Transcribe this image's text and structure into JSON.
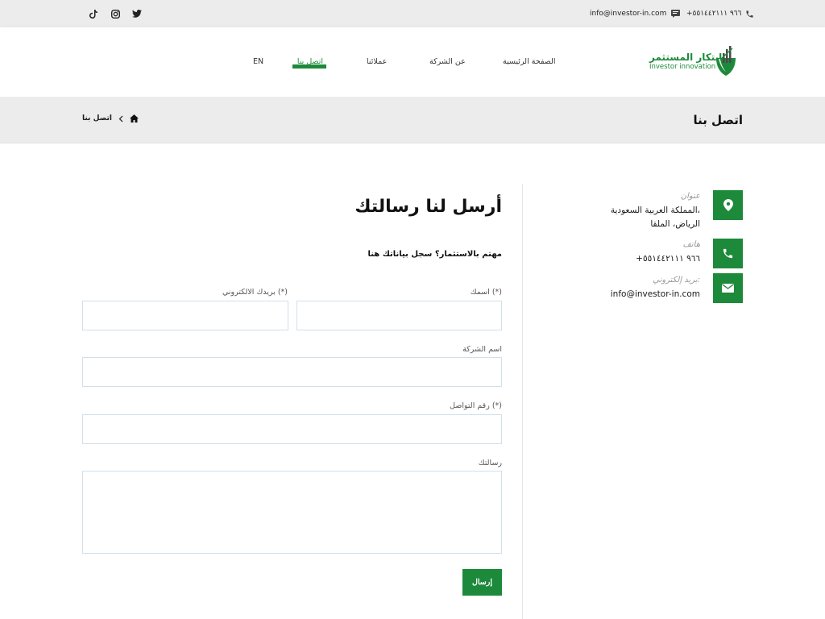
{
  "topbar": {
    "phone": "+٩٦٦ ٥٥١٤٤٢١١١",
    "email": "info@investor-in.com",
    "social": [
      "twitter-icon",
      "instagram-icon",
      "tiktok-icon"
    ]
  },
  "header": {
    "logo_ar": "ابتكار المستثمر",
    "logo_en": "Investor innovation",
    "nav": [
      {
        "label": "الصفحة الرئيسية",
        "active": false
      },
      {
        "label": "عن الشركة",
        "active": false
      },
      {
        "label": "عملائنا",
        "active": false
      },
      {
        "label": "اتصل بنا",
        "active": true
      },
      {
        "label": "EN",
        "active": false
      }
    ]
  },
  "banner": {
    "title": "اتصل بنا",
    "breadcrumb_current": "اتصل بنا"
  },
  "contact_info": {
    "address_label": "عنوان",
    "address_line1": "المملكة العربية السعودية،",
    "address_line2": "الرياض، الملقا",
    "phone_label": "هاتف",
    "phone_value": "+٩٦٦ ٥٥١٤٤٢١١١",
    "email_label": "بريد إلكتروني:",
    "email_value": "info@investor-in.com"
  },
  "form": {
    "title": "أرسل لنا رسالتك",
    "subtitle": "مهتم بالاستثمار؟ سجل بياناتك هنا",
    "name_label": "اسمك (*)",
    "email_label": "بريدك الالكتروني (*)",
    "company_label": "اسم الشركة",
    "phone_label": "رقم التواصل (*)",
    "message_label": "رسالتك",
    "submit_label": "إرسال"
  },
  "colors": {
    "brand": "#1c8a3a",
    "topbar_bg": "#ececec"
  }
}
